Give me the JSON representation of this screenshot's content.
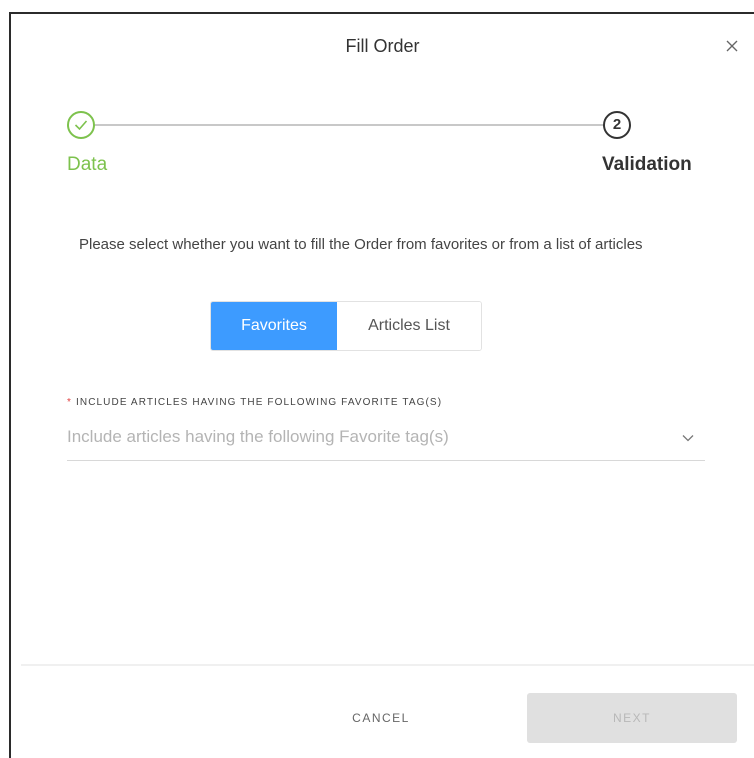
{
  "dialog": {
    "title": "Fill Order"
  },
  "stepper": {
    "steps": [
      {
        "label": "Data",
        "state": "completed"
      },
      {
        "label": "Validation",
        "number": "2",
        "state": "current"
      }
    ],
    "completed_color": "#7dc24d"
  },
  "instructions": "Please select whether you want to fill the Order from favorites or from a list of articles",
  "toggle": {
    "options": [
      "Favorites",
      "Articles List"
    ],
    "selected": "Favorites",
    "accent_color": "#3d9bff"
  },
  "tag_field": {
    "required_marker": "*",
    "label": "INCLUDE ARTICLES HAVING THE FOLLOWING FAVORITE TAG(S)",
    "placeholder": "Include articles having the following Favorite tag(s)"
  },
  "footer": {
    "cancel_label": "CANCEL",
    "next_label": "NEXT"
  },
  "icons": {
    "close": "close-icon",
    "check": "check-icon",
    "dropdown": "chevron-down-icon"
  }
}
